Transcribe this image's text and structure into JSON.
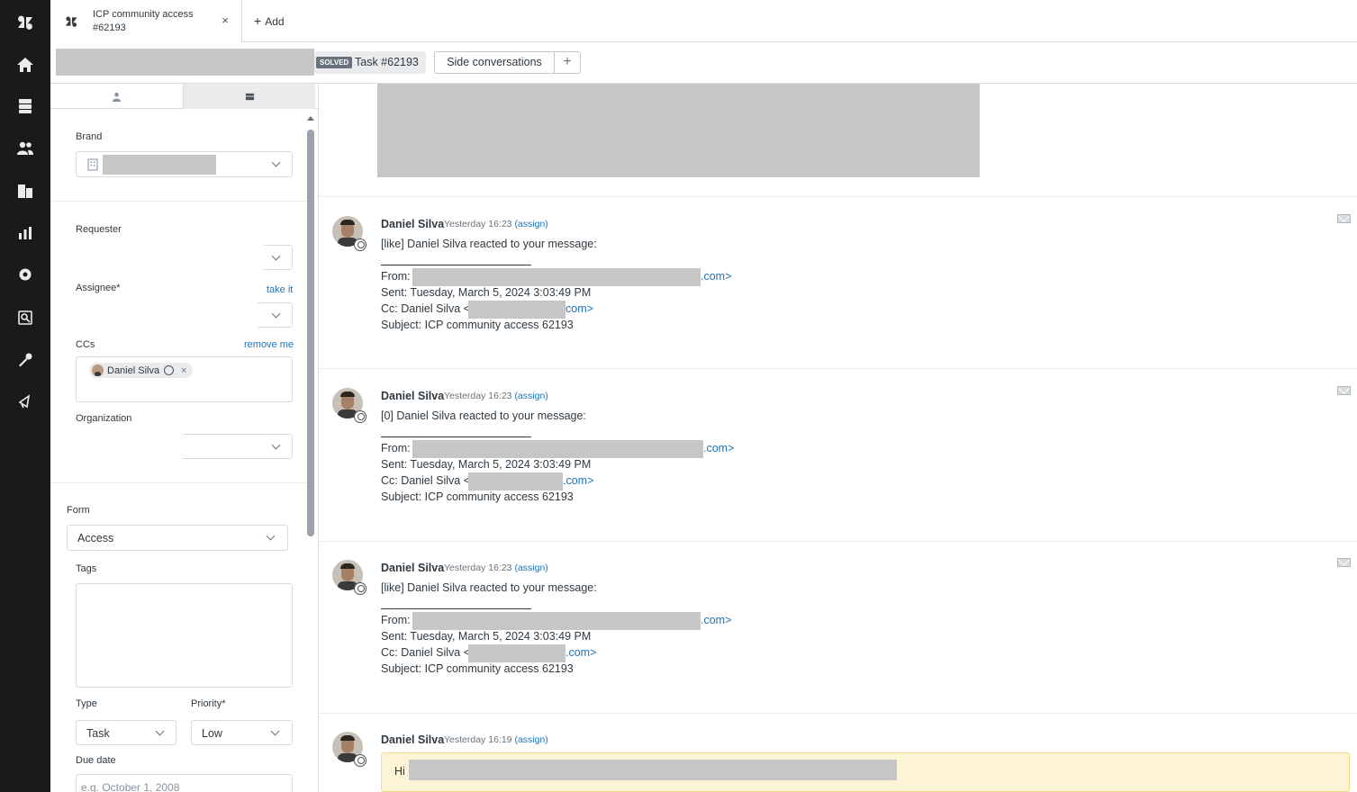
{
  "tab": {
    "title_line1": "ICP community access",
    "title_line2": "#62193",
    "close": "×"
  },
  "add_tab_label": "Add",
  "subbar": {
    "status_badge": "SOLVED",
    "task_label": "Task #62193",
    "side_conversations": "Side conversations",
    "plus": "+"
  },
  "form": {
    "brand_label": "Brand",
    "requester_label": "Requester",
    "assignee_label": "Assignee*",
    "take_it": "take it",
    "ccs_label": "CCs",
    "remove_me": "remove me",
    "cc_chip_name": "Daniel Silva",
    "cc_chip_remove": "×",
    "organization_label": "Organization",
    "form_label": "Form",
    "form_value": "Access",
    "tags_label": "Tags",
    "type_label": "Type",
    "type_value": "Task",
    "priority_label": "Priority*",
    "priority_value": "Low",
    "due_date_label": "Due date",
    "due_date_placeholder": "e.g. October 1, 2008"
  },
  "messages": [
    {
      "author": "Daniel Silva",
      "time": "Yesterday 16:23",
      "assign": "(assign)",
      "body": "[like] Daniel Silva reacted to your message:",
      "from": "From:",
      "from_suffix": ".com>",
      "sent": "Sent: Tuesday, March 5, 2024 3:03:49 PM",
      "cc_prefix": "Cc: Daniel Silva <",
      "cc_suffix": "com>",
      "subject": "Subject: ICP community access 62193"
    },
    {
      "author": "Daniel Silva",
      "time": "Yesterday 16:23",
      "assign": "(assign)",
      "body": "[0] Daniel Silva reacted to your message:",
      "from": "From:",
      "from_suffix": ".com>",
      "sent": "Sent: Tuesday, March 5, 2024 3:03:49 PM",
      "cc_prefix": "Cc: Daniel Silva <",
      "cc_suffix": ".com>",
      "subject": "Subject: ICP community access 62193"
    },
    {
      "author": "Daniel Silva",
      "time": "Yesterday 16:23",
      "assign": "(assign)",
      "body": "[like] Daniel Silva reacted to your message:",
      "from": "From:",
      "from_suffix": ".com>",
      "sent": "Sent: Tuesday, March 5, 2024 3:03:49 PM",
      "cc_prefix": "Cc: Daniel Silva <",
      "cc_suffix": ".com>",
      "subject": "Subject: ICP community access 62193"
    },
    {
      "author": "Daniel Silva",
      "time": "Yesterday 16:19",
      "assign": "(assign)",
      "note_text": "Hi"
    }
  ],
  "icons": [
    "zendesk-logo-icon",
    "home-icon",
    "views-icon",
    "customers-icon",
    "organizations-icon",
    "reporting-icon",
    "admin-icon",
    "explore-icon",
    "apps-icon",
    "support-icon"
  ]
}
